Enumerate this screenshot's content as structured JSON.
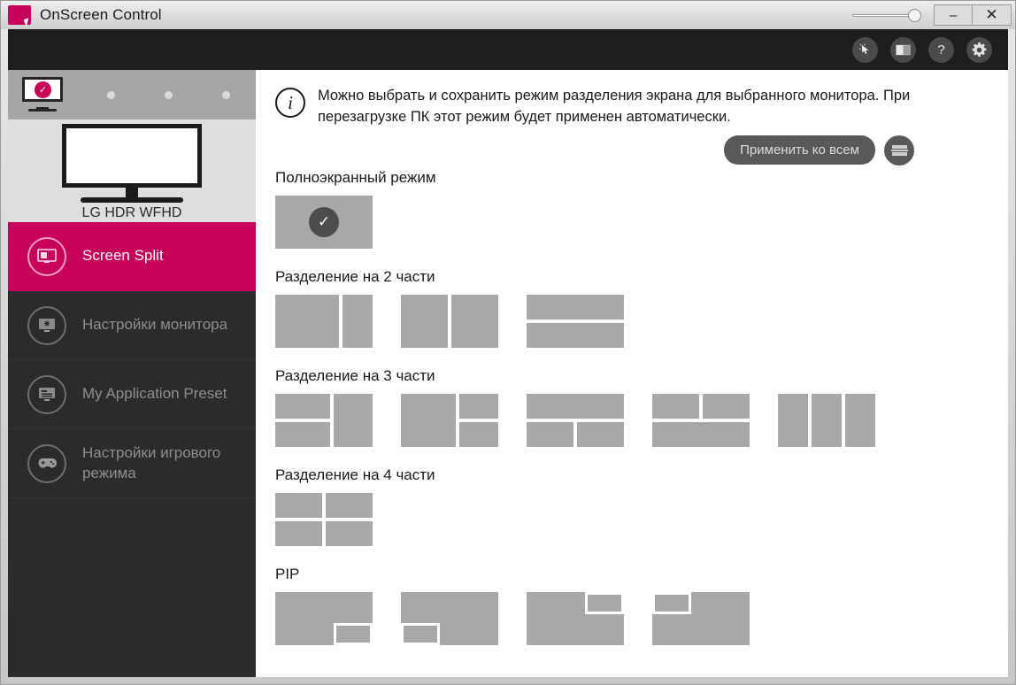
{
  "window": {
    "title": "OnScreen Control",
    "logo_icon": "lg-onscreen-logo-icon",
    "minimize_label": "–",
    "close_label": "✕",
    "opacity_slider_value": "100"
  },
  "toolbar": {
    "icons": [
      {
        "name": "pointer-click-icon",
        "glyph": "➤"
      },
      {
        "name": "screen-split-icon",
        "glyph": "▣"
      },
      {
        "name": "help-icon",
        "glyph": "?"
      },
      {
        "name": "settings-gear-icon",
        "glyph": "⚙"
      }
    ]
  },
  "sidebar": {
    "monitor_bar": {
      "selected_monitor_icon": "monitor-selected-icon",
      "check_glyph": "✓",
      "placeholder_dots": 3
    },
    "monitor_preview": {
      "icon": "monitor-preview-icon",
      "label": "LG HDR WFHD"
    },
    "items": [
      {
        "label": "Screen Split",
        "icon": "screen-split-icon",
        "glyph": "▣",
        "active": true,
        "name": "sidebar-item-screen-split"
      },
      {
        "label": "Настройки монитора",
        "icon": "monitor-settings-icon",
        "glyph": "✹",
        "active": false,
        "name": "sidebar-item-monitor-settings"
      },
      {
        "label": "My Application Preset",
        "icon": "application-preset-icon",
        "glyph": "☲",
        "active": false,
        "name": "sidebar-item-application-preset"
      },
      {
        "label": "Настройки игрового режима",
        "icon": "gamepad-icon",
        "glyph": "❖",
        "active": false,
        "name": "sidebar-item-game-mode-settings"
      }
    ]
  },
  "main": {
    "info": {
      "icon": "info-icon",
      "glyph": "i",
      "text": "Можно выбрать и сохранить режим разделения экрана для выбранного монитора. При перезагрузке ПК этот режим будет применен автоматически."
    },
    "apply_all_label": "Применить ко всем",
    "apply_all_icon": "split-layout-icon",
    "sections": [
      {
        "title": "Полноэкранный режим",
        "name": "section-fullscreen",
        "selected_glyph": "✓"
      },
      {
        "title": "Разделение на 2 части",
        "name": "section-split-2"
      },
      {
        "title": "Разделение на 3 части",
        "name": "section-split-3"
      },
      {
        "title": "Разделение на 4 части",
        "name": "section-split-4"
      },
      {
        "title": "PIP",
        "name": "section-pip"
      }
    ]
  },
  "colors": {
    "accent": "#c7005a",
    "sidebar_bg": "#2b2b2b",
    "tile_gray": "#a8a8a8",
    "toolbar_bg": "#1e1e1e"
  }
}
